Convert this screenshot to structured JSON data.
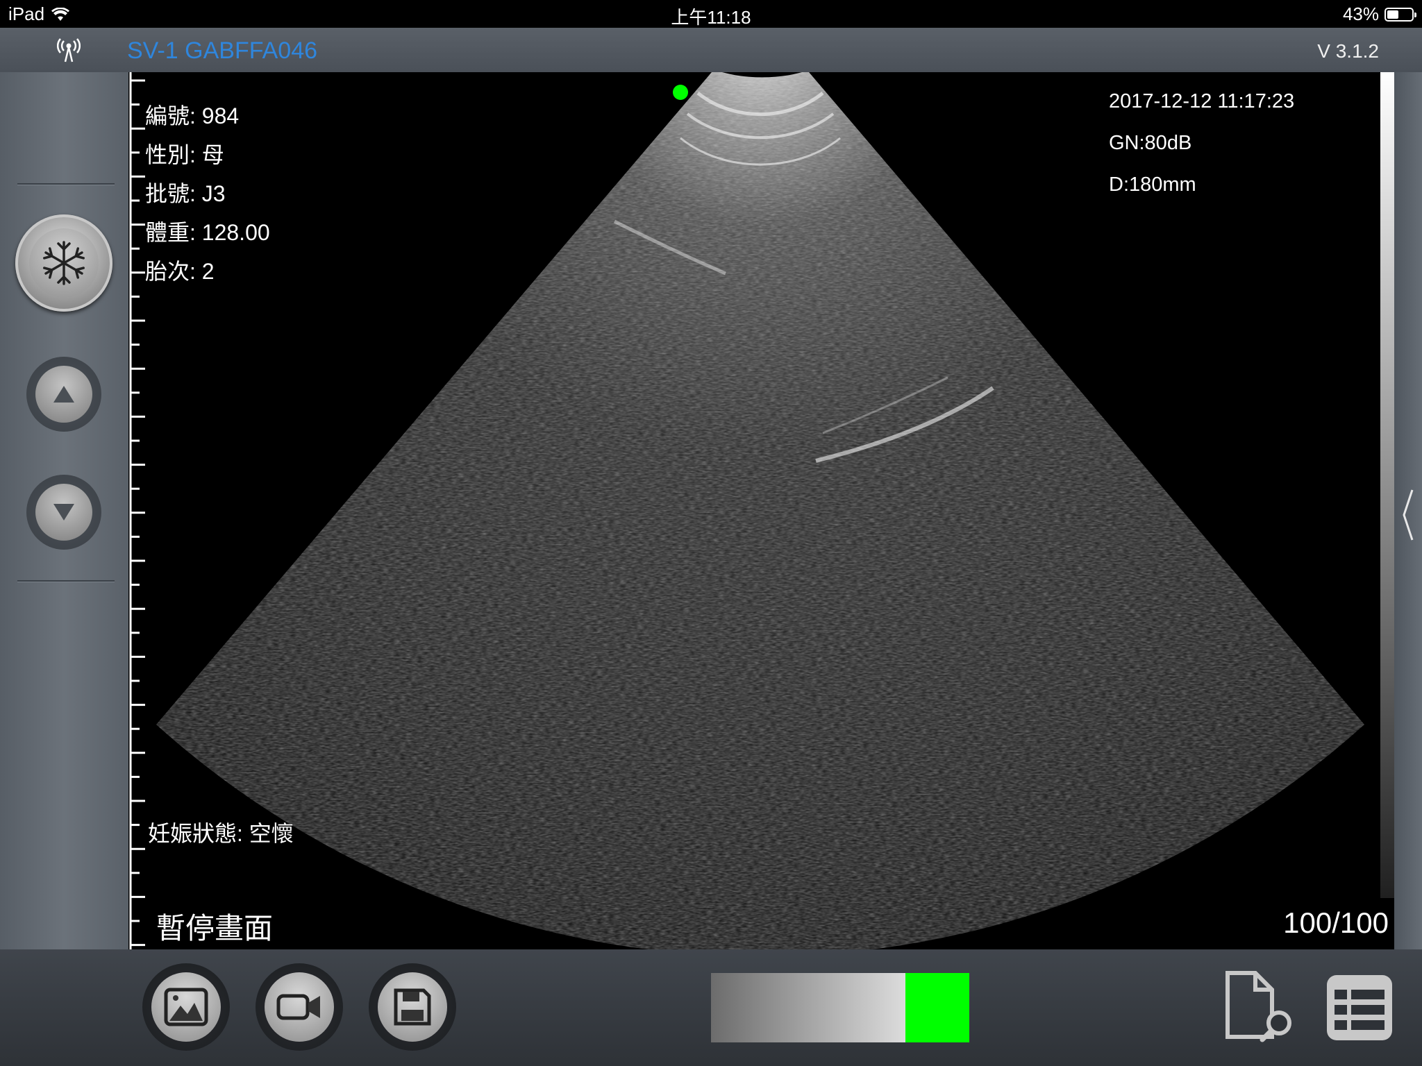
{
  "status_bar": {
    "device": "iPad",
    "time": "上午11:18",
    "battery": "43%",
    "battery_level": 0.43
  },
  "title_bar": {
    "device_name": "SV-1 GABFFA046",
    "version": "V 3.1.2"
  },
  "sidebar": {
    "freeze_icon": "snowflake-icon",
    "up_icon": "triangle-up-icon",
    "down_icon": "triangle-down-icon"
  },
  "info": {
    "id": "編號: 984",
    "sex": "性別: 母",
    "batch": "批號: J3",
    "weight": "體重: 128.00",
    "parity": "胎次: 2",
    "pregnancy": "妊娠狀態: 空懷",
    "paused": "暫停畫面"
  },
  "params": {
    "datetime": "2017-12-12 11:17:23",
    "gain": "GN:80dB",
    "depth": "D:180mm",
    "frame": "100/100"
  },
  "toolbar": {
    "buttons": [
      "image-icon",
      "video-camera-icon",
      "save-disk-icon"
    ],
    "right_buttons": [
      "file-search-icon",
      "table-list-icon"
    ]
  },
  "colors": {
    "accent": "#2f86dd",
    "marker": "#00ff00"
  }
}
